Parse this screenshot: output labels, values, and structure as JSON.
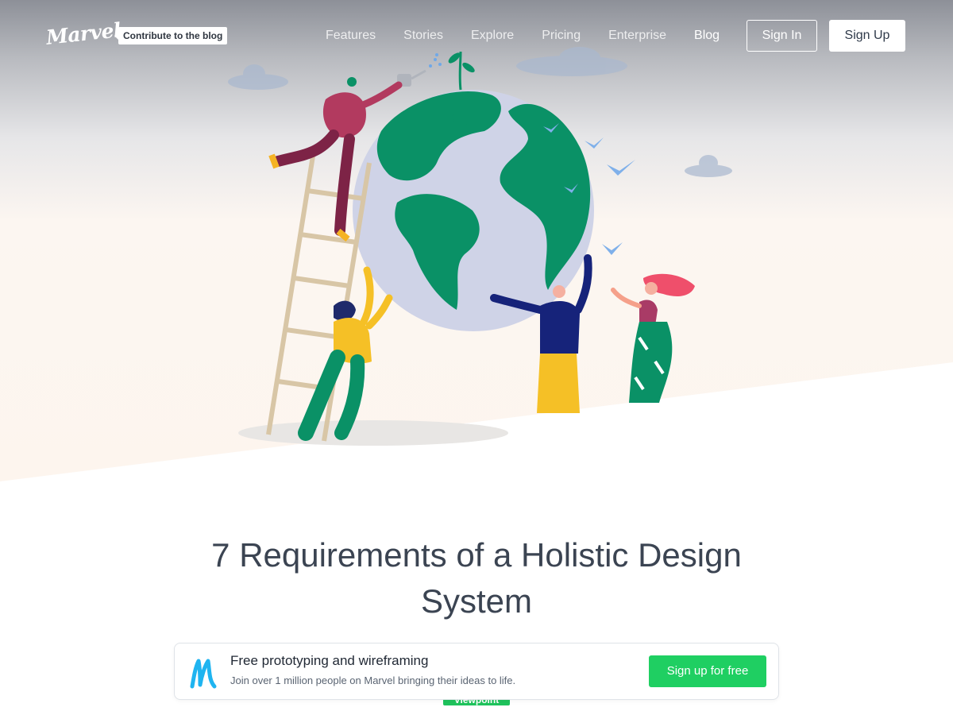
{
  "brand": {
    "logo_text": "Marvel",
    "contribute_label": "Contribute to the blog"
  },
  "nav": {
    "links": [
      "Features",
      "Stories",
      "Explore",
      "Pricing",
      "Enterprise",
      "Blog"
    ],
    "active": "Blog",
    "sign_in": "Sign In",
    "sign_up": "Sign Up"
  },
  "article": {
    "title": "7 Requirements of a Holistic Design System",
    "category_badge": "Viewpoint"
  },
  "banner": {
    "title": "Free prototyping and wireframing",
    "subtitle": "Join over 1 million people on Marvel bringing their ideas to life.",
    "cta": "Sign up for free"
  },
  "colors": {
    "accent_green": "#1fcf62",
    "text_dark": "#3b4452",
    "marvel_blue": "#1fb4f0"
  }
}
